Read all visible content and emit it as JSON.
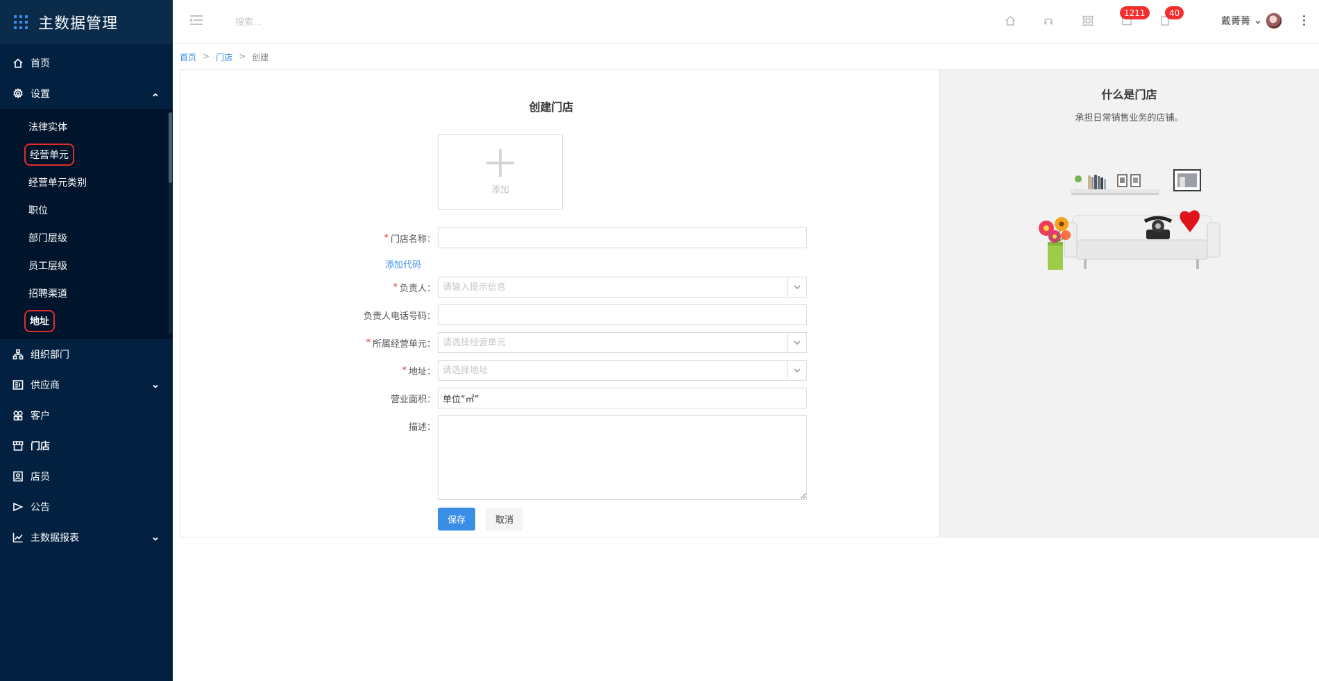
{
  "app": {
    "title": "主数据管理"
  },
  "sidebar": {
    "menu": [
      {
        "label": "首页",
        "icon": "home-icon"
      },
      {
        "label": "设置",
        "icon": "gear-icon",
        "expanded": true
      },
      {
        "label": "组织部门",
        "icon": "org-icon"
      },
      {
        "label": "供应商",
        "icon": "supplier-icon"
      },
      {
        "label": "客户",
        "icon": "customer-icon"
      },
      {
        "label": "门店",
        "icon": "store-icon"
      },
      {
        "label": "店员",
        "icon": "clerk-icon"
      },
      {
        "label": "公告",
        "icon": "announce-icon"
      },
      {
        "label": "主数据报表",
        "icon": "chart-icon"
      }
    ],
    "settings_items": [
      {
        "label": "法律实体"
      },
      {
        "label": "经营单元",
        "highlighted": true
      },
      {
        "label": "经营单元类别"
      },
      {
        "label": "职位"
      },
      {
        "label": "部门层级"
      },
      {
        "label": "员工层级"
      },
      {
        "label": "招聘渠道"
      },
      {
        "label": "地址",
        "highlighted": true
      }
    ]
  },
  "header": {
    "search_placeholder": "搜索...",
    "messages_badge": "1211",
    "notifications_badge": "40",
    "user_name": "戴菁菁"
  },
  "breadcrumb": {
    "home": "首页",
    "store": "门店",
    "current": "创建",
    "separator": ">"
  },
  "form": {
    "title": "创建门店",
    "upload_label": "添加",
    "store_name_label": "门店名称：",
    "add_code_link": "添加代码",
    "manager_label": "负责人：",
    "manager_placeholder": "请输入提示信息",
    "manager_phone_label": "负责人电话号码：",
    "business_unit_label": "所属经营单元：",
    "business_unit_placeholder": "请选择经营单元",
    "address_label": "地址：",
    "address_placeholder": "请选择地址",
    "area_label": "营业面积：",
    "area_value": "单位“㎡”",
    "description_label": "描述：",
    "save_button": "保存",
    "cancel_button": "取消"
  },
  "info": {
    "title": "什么是门店",
    "description": "承担日常销售业务的店铺。"
  },
  "colors": {
    "sidebar_bg": "#02203f",
    "accent": "#3a8ee6",
    "badge": "#f42d2d",
    "highlight_box": "#e42b2b"
  }
}
